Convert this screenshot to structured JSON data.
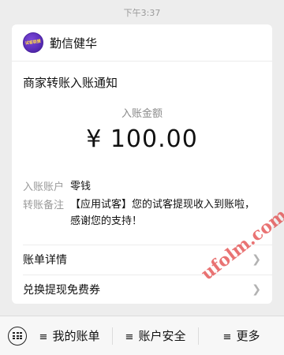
{
  "message_time": "下午3:37",
  "account": {
    "name": "勤信健华",
    "avatar_text": "试客联盟"
  },
  "notice": {
    "title": "商家转账入账通知",
    "amount_label": "入账金额",
    "amount": "¥ 100.00",
    "details": [
      {
        "label": "入账账户",
        "value": "零钱"
      },
      {
        "label": "转账备注",
        "value": "【应用试客】您的试客提现收入到账啦，感谢您的支持！"
      }
    ]
  },
  "links": [
    {
      "label": "账单详情"
    },
    {
      "label": "兑换提现免费券"
    }
  ],
  "bottom_menu": {
    "items": [
      {
        "label": "我的账单"
      },
      {
        "label": "账户安全"
      },
      {
        "label": "更多"
      }
    ]
  },
  "watermark": "ufolm.com"
}
